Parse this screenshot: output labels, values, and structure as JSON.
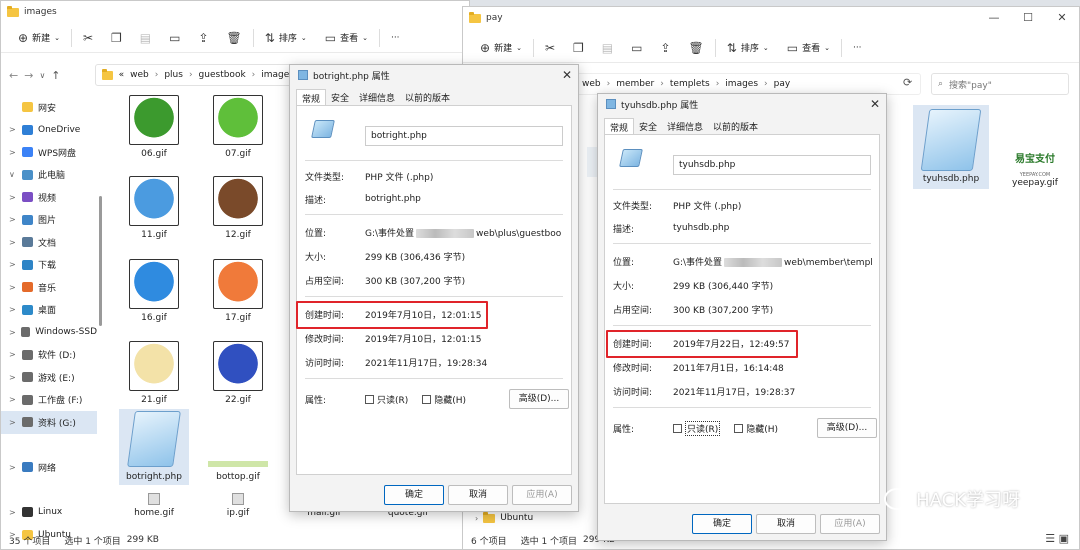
{
  "left_window": {
    "title": "images",
    "toolbar": {
      "new": "新建",
      "sort": "排序",
      "view": "查看",
      "more": "···"
    },
    "breadcrumb": [
      "«",
      "web",
      "plus",
      "guestbook",
      "images"
    ],
    "sidebar": [
      {
        "label": "网安",
        "chev": "",
        "icon": "folder-icon",
        "color": "#f5c542"
      },
      {
        "label": "OneDrive",
        "chev": ">",
        "icon": "cloud-icon",
        "color": "#2f7fd6"
      },
      {
        "label": "WPS网盘",
        "chev": ">",
        "icon": "cloud-icon",
        "color": "#3b82f6"
      },
      {
        "label": "此电脑",
        "chev": "∨",
        "icon": "computer-icon",
        "color": "#4a90c8"
      },
      {
        "label": "视频",
        "chev": ">",
        "icon": "video-icon",
        "color": "#7b4fc4"
      },
      {
        "label": "图片",
        "chev": ">",
        "icon": "picture-icon",
        "color": "#3f85c8"
      },
      {
        "label": "文档",
        "chev": ">",
        "icon": "document-icon",
        "color": "#5a7a99"
      },
      {
        "label": "下载",
        "chev": ">",
        "icon": "download-icon",
        "color": "#2e84c6"
      },
      {
        "label": "音乐",
        "chev": ">",
        "icon": "music-icon",
        "color": "#e46a2a"
      },
      {
        "label": "桌面",
        "chev": ">",
        "icon": "desktop-icon",
        "color": "#2d8ac9"
      },
      {
        "label": "Windows-SSD",
        "chev": ">",
        "icon": "drive-icon",
        "color": "#6b6b6b"
      },
      {
        "label": "软件 (D:)",
        "chev": ">",
        "icon": "drive-icon",
        "color": "#6b6b6b"
      },
      {
        "label": "游戏 (E:)",
        "chev": ">",
        "icon": "drive-icon",
        "color": "#6b6b6b"
      },
      {
        "label": "工作盘 (F:)",
        "chev": ">",
        "icon": "drive-icon",
        "color": "#6b6b6b"
      },
      {
        "label": "资料 (G:)",
        "chev": ">",
        "icon": "drive-icon",
        "color": "#6b6b6b",
        "selected": true
      },
      {
        "label": "",
        "chev": "",
        "icon": "",
        "color": ""
      },
      {
        "label": "网络",
        "chev": ">",
        "icon": "network-icon",
        "color": "#3a7bc0"
      },
      {
        "label": "",
        "chev": "",
        "icon": "",
        "color": ""
      },
      {
        "label": "Linux",
        "chev": ">",
        "icon": "linux-icon",
        "color": "#333"
      },
      {
        "label": "Ubuntu",
        "chev": ">",
        "icon": "folder-icon",
        "color": "#f5c542"
      },
      {
        "label": "Ubuntu",
        "chev": ">",
        "icon": "folder-icon",
        "color": "#f5c542"
      }
    ],
    "files": [
      {
        "name": "06.gif",
        "color": "#3c9a2e"
      },
      {
        "name": "07.gif",
        "color": "#5fbf3a"
      },
      {
        "name": "11.gif",
        "color": "#4b9be0"
      },
      {
        "name": "12.gif",
        "color": "#7a4a2a"
      },
      {
        "name": "16.gif",
        "color": "#2f8be0"
      },
      {
        "name": "17.gif",
        "color": "#f07a3a"
      },
      {
        "name": "21.gif",
        "color": "#f3e2a8"
      },
      {
        "name": "22.gif",
        "color": "#3050c0"
      },
      {
        "name": "botright.php",
        "color": "#7fb6e2"
      },
      {
        "name": "bottop.gif",
        "color": "#cfe6a8"
      },
      {
        "name": "home.gif",
        "color": "#e0e0e0"
      },
      {
        "name": "ip.gif",
        "color": "#e0e0e0"
      },
      {
        "name": "mail.gif",
        "color": "#e0e0e0"
      },
      {
        "name": "quote.gif",
        "color": "#e0e0e0"
      }
    ],
    "status": {
      "count": "35 个项目",
      "selected": "选中 1 个项目",
      "size": "299 KB"
    }
  },
  "right_window": {
    "title": "pay",
    "toolbar": {
      "new": "新建",
      "sort": "排序",
      "view": "查看",
      "more": "···"
    },
    "breadcrumb": [
      "web",
      "member",
      "templets",
      "images",
      "pay"
    ],
    "search_placeholder": "搜索\"pay\"",
    "files": [
      {
        "name": "tyuhsdb.php",
        "color": "#7fb6e2"
      },
      {
        "name": "yeepay.gif",
        "color": "#ffffff"
      }
    ],
    "yeepay_text": "易宝支付",
    "yeepay_sub": "YEEPAY.COM",
    "sidebar_bottom": "Ubuntu",
    "status": {
      "count": "6 个项目",
      "selected": "选中 1 个项目",
      "size": "299 KB"
    }
  },
  "dialog_left": {
    "title": "botright.php 属性",
    "tabs": [
      "常规",
      "安全",
      "详细信息",
      "以前的版本"
    ],
    "filename": "botright.php",
    "file_type_label": "文件类型:",
    "file_type": "PHP 文件 (.php)",
    "desc_label": "描述:",
    "desc": "botright.php",
    "location_label": "位置:",
    "location_prefix": "G:\\事件处置",
    "location_suffix": "web\\plus\\guestboo",
    "size_label": "大小:",
    "size": "299 KB (306,436 字节)",
    "disk_label": "占用空间:",
    "disk": "300 KB (307,200 字节)",
    "created_label": "创建时间:",
    "created": "2019年7月10日，12:01:15",
    "modified_label": "修改时间:",
    "modified": "2019年7月10日，12:01:15",
    "accessed_label": "访问时间:",
    "accessed": "2021年11月17日，19:28:34",
    "attr_label": "属性:",
    "readonly": "只读(R)",
    "hidden": "隐藏(H)",
    "advanced": "高级(D)...",
    "ok": "确定",
    "cancel": "取消",
    "apply": "应用(A)"
  },
  "dialog_right": {
    "title": "tyuhsdb.php 属性",
    "tabs": [
      "常规",
      "安全",
      "详细信息",
      "以前的版本"
    ],
    "filename": "tyuhsdb.php",
    "file_type_label": "文件类型:",
    "file_type": "PHP 文件 (.php)",
    "desc_label": "描述:",
    "desc": "tyuhsdb.php",
    "location_label": "位置:",
    "location_prefix": "G:\\事件处置",
    "location_suffix": "web\\member\\templ",
    "size_label": "大小:",
    "size": "299 KB (306,440 字节)",
    "disk_label": "占用空间:",
    "disk": "300 KB (307,200 字节)",
    "created_label": "创建时间:",
    "created": "2019年7月22日，12:49:57",
    "modified_label": "修改时间:",
    "modified": "2011年7月1日，16:14:48",
    "accessed_label": "访问时间:",
    "accessed": "2021年11月17日，19:28:37",
    "attr_label": "属性:",
    "readonly": "只读(R)",
    "hidden": "隐藏(H)",
    "advanced": "高级(D)...",
    "ok": "确定",
    "cancel": "取消",
    "apply": "应用(A)"
  },
  "watermark": "HACK学习呀",
  "colors": {
    "highlight": "#e0242a",
    "accent": "#0067c0"
  }
}
